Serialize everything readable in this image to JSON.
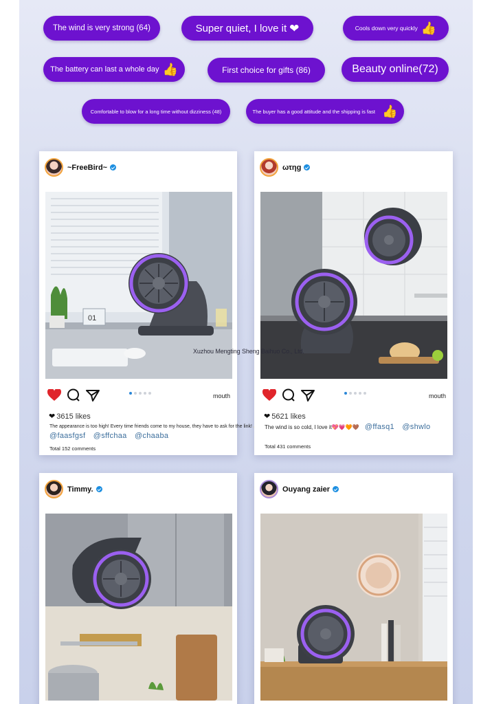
{
  "tags": [
    {
      "text": "The wind is very strong (64)",
      "thumb": false
    },
    {
      "text": "Super quiet, I love it",
      "thumb": false,
      "heart": true
    },
    {
      "text": "Cools down very quickly",
      "thumb": true
    },
    {
      "text": "The battery can last a whole day",
      "thumb": true
    },
    {
      "text": "First choice for gifts (86)",
      "thumb": false
    },
    {
      "text": "Beauty online(72)",
      "thumb": false
    },
    {
      "text": "Comfortable to blow for a long time without dizziness (48)",
      "thumb": false
    },
    {
      "text": "The buyer has a good attitude and the shipping is fast",
      "thumb": true
    }
  ],
  "cards": [
    {
      "user": "~FreeBird~",
      "mouth": "mouth",
      "likes": "3615 likes",
      "caption": "The appearance is too high! Every time friends come to my house, they have to ask for the link! 👍",
      "mentions": [
        "@faasfgsf",
        "@sffchaa",
        "@chaaba"
      ],
      "comments": "Total 152 comments"
    },
    {
      "user": "ωτηg",
      "mouth": "mouth",
      "likes": "5621 likes",
      "caption": "The wind is so cold, I love it💖💗🧡🤎",
      "mentions": [
        "@ffasq1",
        "@shwlo"
      ],
      "comments": "Total 431 comments"
    },
    {
      "user": "Timmy."
    },
    {
      "user": "Ouyang zaier"
    }
  ],
  "watermark": "Xuzhou Mengting Sheng Baihuo Co., Ltd.",
  "colors": {
    "tag": "#6d12cf",
    "heart": "#e0252b",
    "fan_ring": "#8a4bea",
    "link": "#3c6e9c"
  }
}
